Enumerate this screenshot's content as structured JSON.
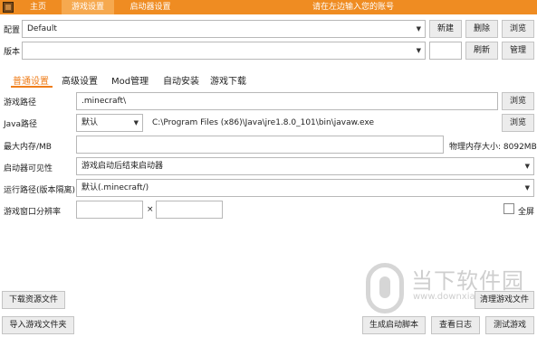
{
  "titlebar": {
    "tabs": [
      {
        "label": "主页"
      },
      {
        "label": "游戏设置"
      },
      {
        "label": "启动器设置"
      }
    ],
    "prompt": "请在左边输入您的账号"
  },
  "config": {
    "label": "配置",
    "value": "Default",
    "new_button": "新建",
    "delete_button": "删除",
    "browse_button": "浏览"
  },
  "version": {
    "label": "版本",
    "value": "",
    "refresh_button": "刷新",
    "manage_button": "管理"
  },
  "subtabs": [
    {
      "label": "普通设置"
    },
    {
      "label": "高级设置"
    },
    {
      "label": "Mod管理"
    },
    {
      "label": "自动安装"
    },
    {
      "label": "游戏下载"
    }
  ],
  "settings": {
    "game_path": {
      "label": "游戏路径",
      "value": ".minecraft\\",
      "browse": "浏览"
    },
    "java_path": {
      "label": "Java路径",
      "selected": "默认",
      "value": "C:\\Program Files (x86)\\Java\\jre1.8.0_101\\bin\\javaw.exe",
      "browse": "浏览"
    },
    "max_memory": {
      "label": "最大内存/MB",
      "value": "",
      "physical": "物理内存大小: 8092MB"
    },
    "launcher_visibility": {
      "label": "启动器可见性",
      "selected": "游戏启动后结束启动器"
    },
    "run_path": {
      "label": "运行路径(版本隔离)",
      "selected": "默认(.minecraft/)"
    },
    "resolution": {
      "label": "游戏窗口分辨率",
      "width": "",
      "height": "",
      "separator": "×",
      "fullscreen_label": "全屏"
    }
  },
  "bottom": {
    "download_resources": "下载资源文件",
    "clean_game_files": "清理游戏文件",
    "import_game_folder": "导入游戏文件夹",
    "generate_script": "生成启动脚本",
    "view_log": "查看日志",
    "test_game": "测试游戏"
  },
  "watermark": {
    "text": "当下软件园",
    "url": "www.downxia.com"
  },
  "colors": {
    "accent": "#ef8c22",
    "active_tab": "#f6a94f",
    "subtab_active": "#ef7d1a"
  }
}
